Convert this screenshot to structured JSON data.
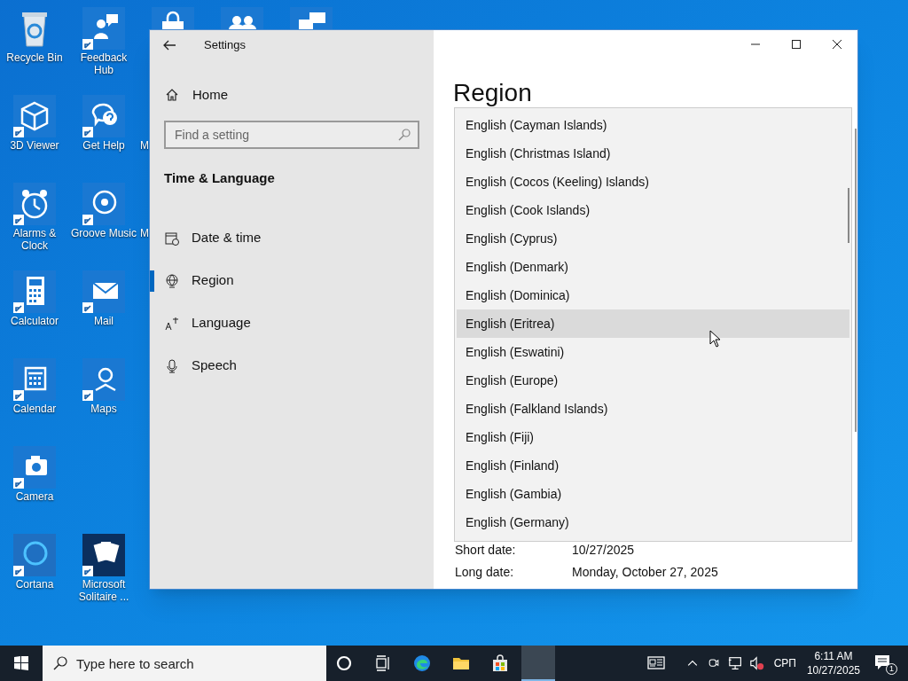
{
  "desktop": {
    "columns": [
      [
        {
          "kind": "recycle",
          "label": "Recycle Bin",
          "shortcut": false
        },
        {
          "kind": "cube",
          "label": "3D Viewer",
          "shortcut": true
        },
        {
          "kind": "alarm",
          "label": "Alarms & Clock",
          "shortcut": true
        },
        {
          "kind": "calculator",
          "label": "Calculator",
          "shortcut": true
        },
        {
          "kind": "calendar",
          "label": "Calendar",
          "shortcut": true
        },
        {
          "kind": "camera",
          "label": "Camera",
          "shortcut": true
        },
        {
          "kind": "cortana",
          "label": "Cortana",
          "shortcut": true
        }
      ],
      [
        {
          "kind": "feedback",
          "label": "Feedback Hub",
          "shortcut": true
        },
        {
          "kind": "help",
          "label": "Get Help",
          "shortcut": true
        },
        {
          "kind": "groove",
          "label": "Groove Music",
          "shortcut": true
        },
        {
          "kind": "mail",
          "label": "Mail",
          "shortcut": true
        },
        {
          "kind": "maps",
          "label": "Maps",
          "shortcut": true
        },
        {
          "kind": "blank"
        },
        {
          "kind": "cards",
          "label": "Microsoft Solitaire ...",
          "shortcut": true
        }
      ],
      [
        {
          "kind": "store-cut"
        },
        {
          "kind": "label-only",
          "label": "M"
        },
        {
          "kind": "label-only",
          "label": "M"
        }
      ],
      [
        {
          "kind": "people-cut"
        }
      ],
      [
        {
          "kind": "chat-cut"
        }
      ]
    ]
  },
  "window": {
    "title": "Settings",
    "sidebar": {
      "home": "Home",
      "search": {
        "placeholder": "Find a setting"
      },
      "section": "Time & Language",
      "items": [
        {
          "kind": "calendar",
          "label": "Date & time",
          "selected": false
        },
        {
          "kind": "globe",
          "label": "Region",
          "selected": true
        },
        {
          "kind": "language",
          "label": "Language",
          "selected": false
        },
        {
          "kind": "mic",
          "label": "Speech",
          "selected": false
        }
      ]
    },
    "page_title": "Region",
    "dropdown": [
      {
        "label": "English (Cayman Islands)",
        "hovered": false
      },
      {
        "label": "English (Christmas Island)",
        "hovered": false
      },
      {
        "label": "English (Cocos (Keeling) Islands)",
        "hovered": false
      },
      {
        "label": "English (Cook Islands)",
        "hovered": false
      },
      {
        "label": "English (Cyprus)",
        "hovered": false
      },
      {
        "label": "English (Denmark)",
        "hovered": false
      },
      {
        "label": "English (Dominica)",
        "hovered": false
      },
      {
        "label": "English (Eritrea)",
        "hovered": true
      },
      {
        "label": "English (Eswatini)",
        "hovered": false
      },
      {
        "label": "English (Europe)",
        "hovered": false
      },
      {
        "label": "English (Falkland Islands)",
        "hovered": false
      },
      {
        "label": "English (Fiji)",
        "hovered": false
      },
      {
        "label": "English (Finland)",
        "hovered": false
      },
      {
        "label": "English (Gambia)",
        "hovered": false
      },
      {
        "label": "English (Germany)",
        "hovered": false
      }
    ],
    "formats": [
      {
        "label": "Short date:",
        "value": "10/27/2025"
      },
      {
        "label": "Long date:",
        "value": "Monday, October 27, 2025"
      }
    ]
  },
  "taskbar": {
    "search": {
      "placeholder": "Type here to search"
    },
    "apps": [
      {
        "kind": "ring",
        "active": false
      },
      {
        "kind": "taskview",
        "active": false
      },
      {
        "kind": "edge",
        "active": false
      },
      {
        "kind": "folder",
        "active": false
      },
      {
        "kind": "store",
        "active": false
      },
      {
        "kind": "blank",
        "active": true
      }
    ],
    "tray": {
      "language": "СРП",
      "time": "6:11 AM",
      "date": "10/27/2025",
      "notifications": "1"
    }
  }
}
